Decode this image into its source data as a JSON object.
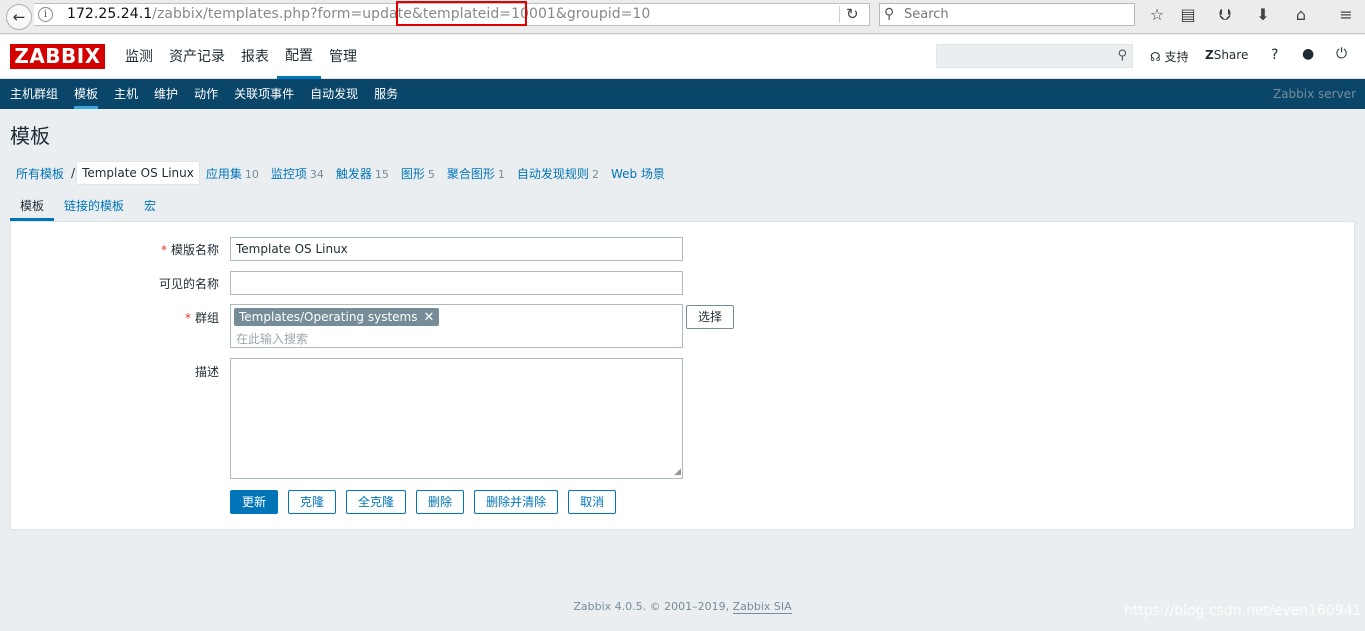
{
  "browser": {
    "url_host": "172.25.24.1",
    "url_path_a": "/zabbix/templates.php?form=update&",
    "url_highlight": "templateid=10001",
    "url_path_b": "&groupid=10",
    "search_placeholder": "Search"
  },
  "header": {
    "logo": "ZABBIX",
    "menu": [
      {
        "label": "监测"
      },
      {
        "label": "资产记录"
      },
      {
        "label": "报表"
      },
      {
        "label": "配置"
      },
      {
        "label": "管理"
      }
    ],
    "support_label": "支持",
    "share_label": "Share",
    "help_label": "?"
  },
  "submenu": {
    "items": [
      {
        "label": "主机群组"
      },
      {
        "label": "模板"
      },
      {
        "label": "主机"
      },
      {
        "label": "维护"
      },
      {
        "label": "动作"
      },
      {
        "label": "关联项事件"
      },
      {
        "label": "自动发现"
      },
      {
        "label": "服务"
      }
    ],
    "server": "Zabbix server"
  },
  "page": {
    "title": "模板",
    "breadcrumbs": {
      "all": "所有模板",
      "sep": "/",
      "current": "Template OS Linux",
      "apps": "应用集",
      "apps_count": "10",
      "items": "监控项",
      "items_count": "34",
      "triggers": "触发器",
      "triggers_count": "15",
      "graphs": "图形",
      "graphs_count": "5",
      "screens": "聚合图形",
      "screens_count": "1",
      "discovery": "自动发现规则",
      "discovery_count": "2",
      "web": "Web 场景"
    },
    "tabs": [
      "模板",
      "链接的模板",
      "宏"
    ]
  },
  "form": {
    "required_mark": "*",
    "name_label": "模版名称",
    "name_value": "Template OS Linux",
    "visible_label": "可见的名称",
    "visible_value": "",
    "group_label": "群组",
    "group_chip": "Templates/Operating systems",
    "group_placeholder": "在此输入搜索",
    "select_button": "选择",
    "desc_label": "描述",
    "buttons": {
      "update": "更新",
      "clone": "克隆",
      "full_clone": "全克隆",
      "delete": "删除",
      "delete_clear": "删除并清除",
      "cancel": "取消"
    }
  },
  "footer": {
    "text": "Zabbix 4.0.5. © 2001–2019,",
    "link": "Zabbix SIA"
  },
  "watermark": "https://blog.csdn.net/even160941"
}
